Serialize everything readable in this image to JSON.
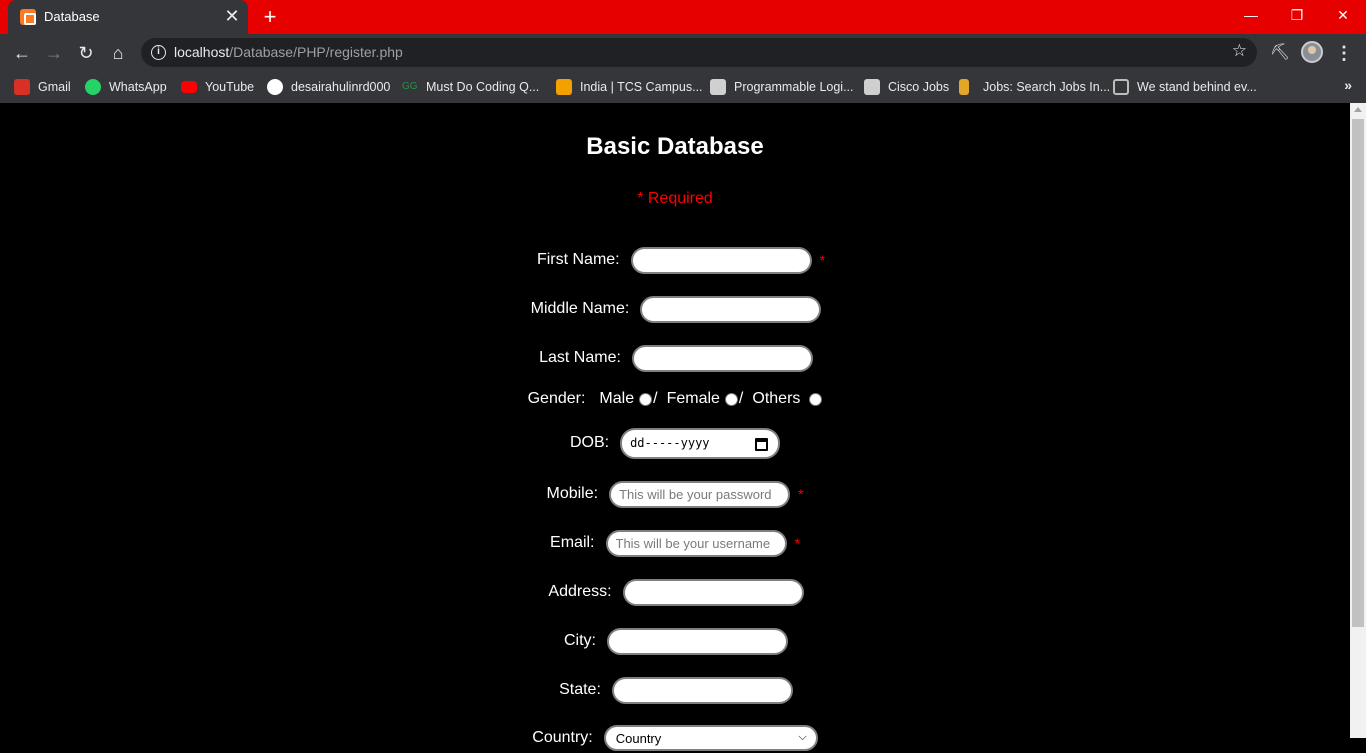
{
  "browser": {
    "tab_title": "Database",
    "tab_close": "✕",
    "new_tab": "+",
    "window_controls": {
      "minimize": "—",
      "restore": "❐",
      "close": "✕"
    },
    "url_host": "localhost",
    "url_path": "/Database/PHP/register.php",
    "bookmarks": [
      {
        "label": "Gmail",
        "icon": "gmail-icon",
        "color": "#d93025"
      },
      {
        "label": "WhatsApp",
        "icon": "whatsapp-icon",
        "color": "#25d366"
      },
      {
        "label": "YouTube",
        "icon": "youtube-icon",
        "color": "#ff0000"
      },
      {
        "label": "desairahulinrd000",
        "icon": "github-icon",
        "color": "#ffffff"
      },
      {
        "label": "Must Do Coding Q...",
        "icon": "geeksforgeeks-icon",
        "color": "#2f8d46"
      },
      {
        "label": "India | TCS Campus...",
        "icon": "tcs-icon",
        "color": "#f4a000"
      },
      {
        "label": "Programmable Logi...",
        "icon": "programmable-logic-icon",
        "color": "#d0d0d0"
      },
      {
        "label": "Cisco Jobs",
        "icon": "cisco-icon",
        "color": "#cfcfcf"
      },
      {
        "label": "Jobs: Search Jobs In...",
        "icon": "jobs-icon",
        "color": "#e2a629"
      },
      {
        "label": "We stand behind ev...",
        "icon": "page-icon",
        "color": "#bdbdbd"
      }
    ],
    "bookmarks_more": "»",
    "accent_color": "#e60000"
  },
  "form": {
    "title": "Basic Database",
    "required_note": "* Required",
    "required_star": "*",
    "first_name_label": "First Name:",
    "middle_name_label": "Middle Name:",
    "last_name_label": "Last Name:",
    "gender_label": "Gender:",
    "gender_options": [
      "Male",
      "Female",
      "Others"
    ],
    "gender_separator": "/",
    "dob_label": "DOB:",
    "dob_placeholder": "dd-----yyyy",
    "mobile_label": "Mobile:",
    "mobile_placeholder": "This will be your password",
    "email_label": "Email:",
    "email_placeholder": "This will be your username",
    "address_label": "Address:",
    "city_label": "City:",
    "state_label": "State:",
    "country_label": "Country:",
    "country_selected": "Country"
  }
}
